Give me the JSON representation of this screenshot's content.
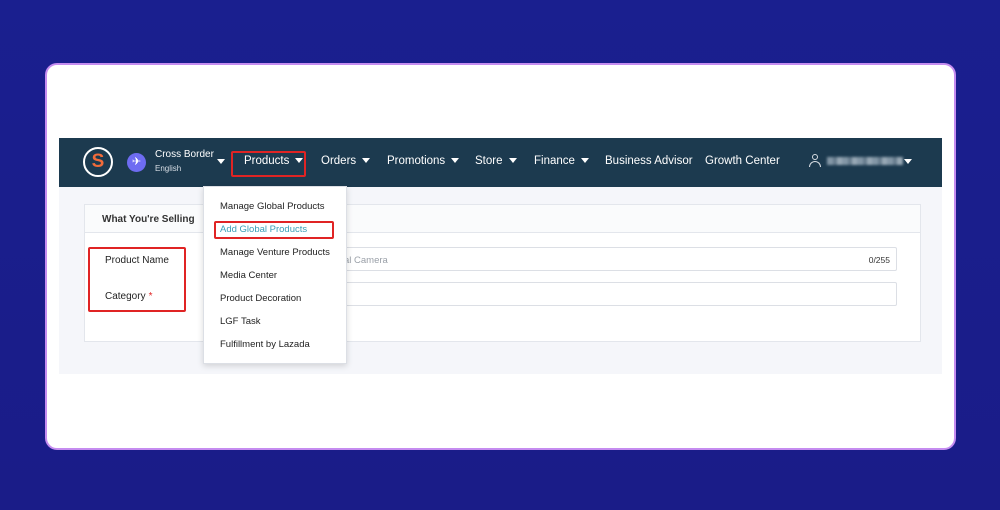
{
  "header": {
    "logo_letter": "S",
    "region_title": "Cross Border",
    "region_lang": "English",
    "nav": [
      {
        "label": "Products"
      },
      {
        "label": "Orders"
      },
      {
        "label": "Promotions"
      },
      {
        "label": "Store"
      },
      {
        "label": "Finance"
      },
      {
        "label": "Business Advisor"
      },
      {
        "label": "Growth Center"
      }
    ]
  },
  "products_menu": {
    "items": [
      {
        "label": "Manage Global Products"
      },
      {
        "label": "Add Global Products"
      },
      {
        "label": "Manage Venture Products"
      },
      {
        "label": "Media Center"
      },
      {
        "label": "Product Decoration"
      },
      {
        "label": "LGF Task"
      },
      {
        "label": "Fulfillment by Lazada"
      }
    ]
  },
  "form": {
    "section_title": "What You're Selling",
    "product_name_label": "Product Name",
    "product_name_placeholder": "al Camera",
    "product_name_counter": "0/255",
    "category_label": "Category",
    "required_mark": "*"
  },
  "colors": {
    "navbar": "#1c3a4f",
    "highlight": "#e02424",
    "active_link": "#3aa0b8",
    "page_bg": "#1a1f8f"
  }
}
